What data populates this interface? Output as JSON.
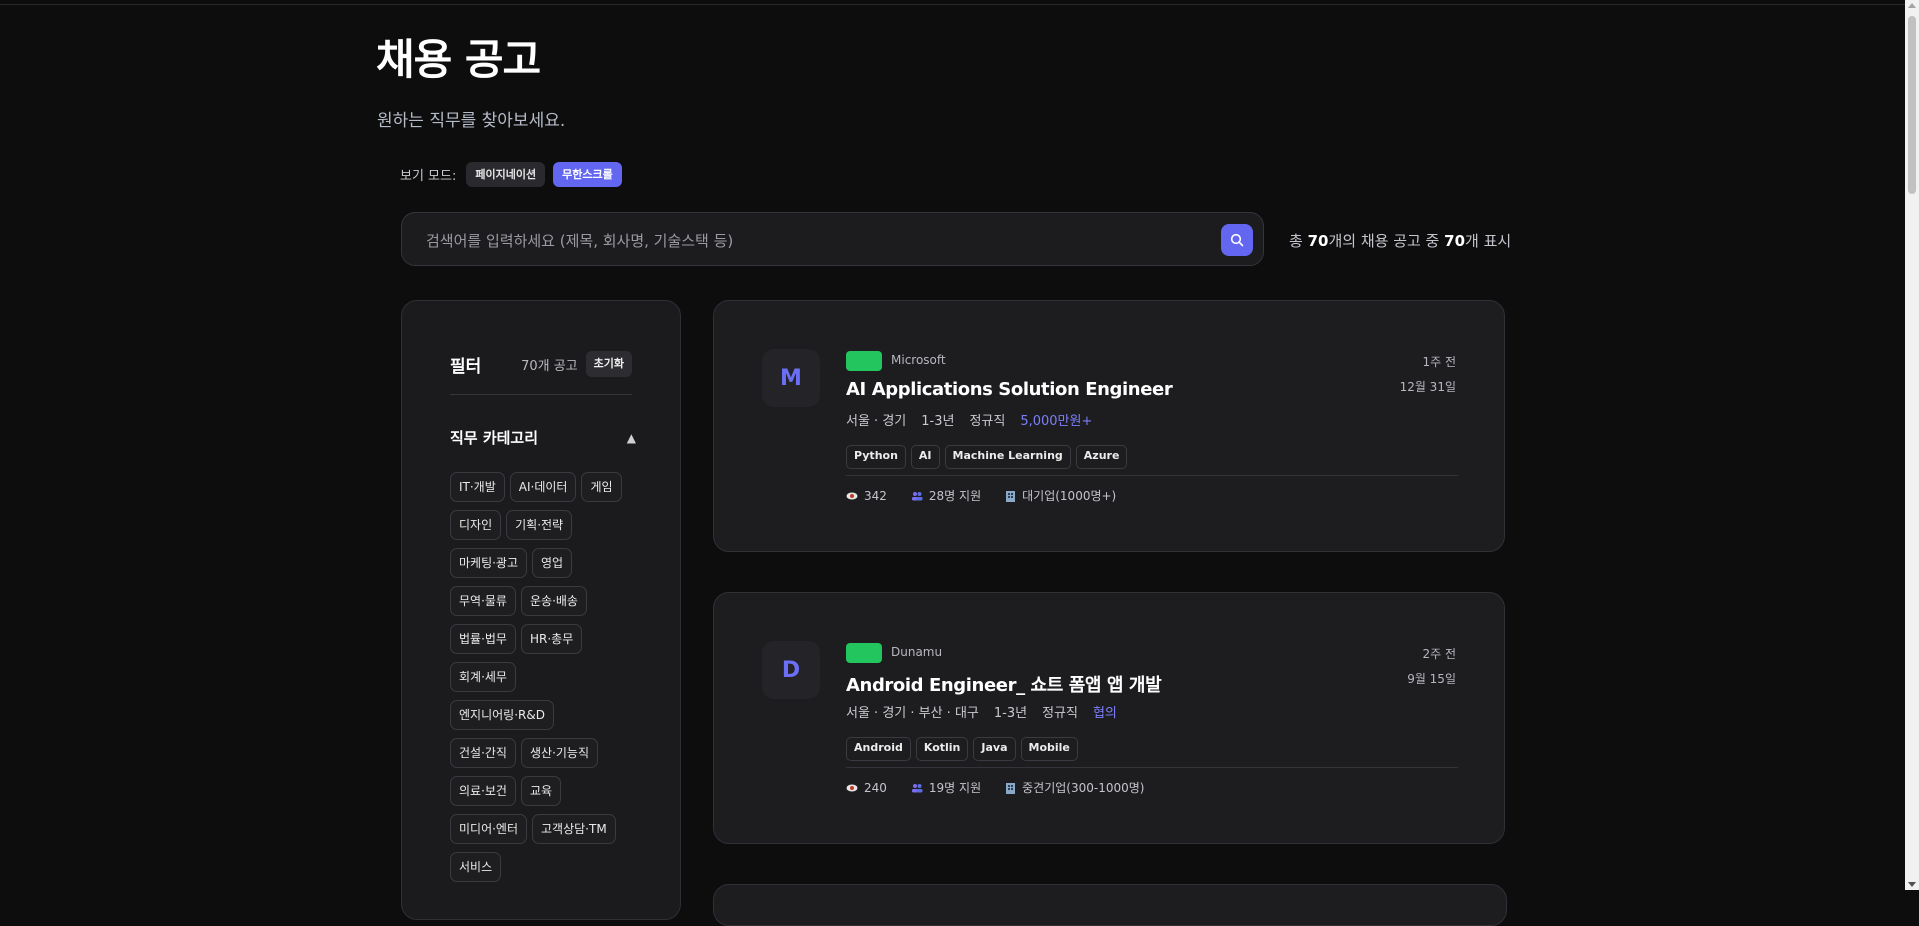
{
  "page": {
    "title": "채용 공고",
    "subtitle": "원하는 직무를 찾아보세요."
  },
  "view_mode": {
    "label": "보기 모드:",
    "options": [
      "페이지네이션",
      "무한스크롤"
    ],
    "selected": "무한스크롤"
  },
  "search": {
    "placeholder": "검색어를 입력하세요 (제목, 회사명, 기술스택 등)",
    "value": "",
    "icon": "search-icon"
  },
  "results": {
    "prefix": "총 ",
    "total": "70",
    "mid": "개의 채용 공고 중 ",
    "shown": "70",
    "suffix": "개 표시"
  },
  "filter": {
    "title": "필터",
    "count": "70개 공고",
    "reset_label": "초기화",
    "section_label": "직무 카테고리",
    "toggle_icon": "▲",
    "categories": [
      "IT·개발",
      "AI·데이터",
      "게임",
      "디자인",
      "기획·전략",
      "마케팅·광고",
      "영업",
      "무역·물류",
      "운송·배송",
      "법률·법무",
      "HR·총무",
      "회계·세무",
      "엔지니어링·R&D",
      "건설·간직",
      "생산·기능직",
      "의료·보건",
      "교육",
      "미디어·엔터",
      "고객상담·TM",
      "서비스"
    ]
  },
  "accent_color": "#6366f1",
  "badge_color": "#22c55e",
  "jobs": [
    {
      "logo_letter": "M",
      "company": "Microsoft",
      "title": "AI Applications Solution Engineer",
      "location": "서울 · 경기",
      "experience": "1-3년",
      "type": "정규직",
      "salary": "5,000만원+",
      "posted": "1주 전",
      "deadline": "12월 31일",
      "tags": [
        "Python",
        "AI",
        "Machine Learning",
        "Azure"
      ],
      "views": "342",
      "applicants": "28명 지원",
      "company_size": "대기업(1000명+)"
    },
    {
      "logo_letter": "D",
      "company": "Dunamu",
      "title": "Android Engineer_ 쇼트 폼앱 앱 개발",
      "location": "서울 · 경기 · 부산 · 대구",
      "experience": "1-3년",
      "type": "정규직",
      "salary": "협의",
      "posted": "2주 전",
      "deadline": "9월 15일",
      "tags": [
        "Android",
        "Kotlin",
        "Java",
        "Mobile"
      ],
      "views": "240",
      "applicants": "19명 지원",
      "company_size": "중견기업(300-1000명)"
    }
  ]
}
